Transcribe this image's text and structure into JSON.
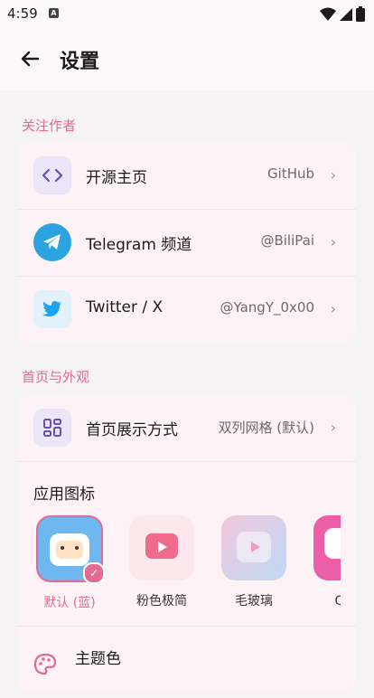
{
  "status_bar": {
    "time": "4:59",
    "app_glyph": "A"
  },
  "header": {
    "title": "设置",
    "back_icon": "arrow-left-icon"
  },
  "sections": {
    "follow_author": {
      "title": "关注作者",
      "items": [
        {
          "label": "开源主页",
          "value": "GitHub",
          "icon": "code-icon"
        },
        {
          "label": "Telegram 频道",
          "value": "@BiliPai",
          "icon": "telegram-icon"
        },
        {
          "label": "Twitter / X",
          "value": "@YangY_0x00",
          "icon": "twitter-icon"
        }
      ]
    },
    "home_appearance": {
      "title": "首页与外观",
      "display_mode": {
        "label": "首页展示方式",
        "value": "双列网格 (默认)",
        "icon": "grid-icon"
      },
      "app_icon": {
        "title": "应用图标",
        "options": [
          {
            "label": "默认 (蓝)",
            "selected": true
          },
          {
            "label": "粉色极简",
            "selected": false
          },
          {
            "label": "毛玻璃",
            "selected": false
          },
          {
            "label": "Q版",
            "selected": false
          }
        ]
      },
      "theme_color": {
        "label": "主题色",
        "icon": "palette-icon"
      }
    }
  },
  "colors": {
    "accent": "#e46a93",
    "card_bg": "#fdf2f5",
    "page_bg": "#f6f3f4"
  }
}
